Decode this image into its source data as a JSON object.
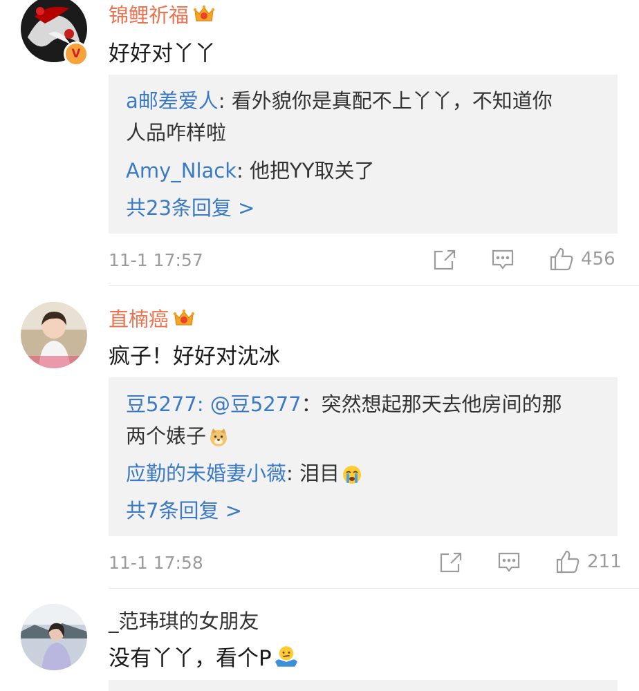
{
  "comments": [
    {
      "username": "锦鲤祈福",
      "text": "好好对丫丫",
      "replies": [
        {
          "user": "a邮差爱人",
          "sep": ": ",
          "text_line1": "看外貌你是真配不上丫丫，不知道你",
          "text_line2": "人品咋样啦"
        },
        {
          "user": "Amy_Nlack",
          "sep": ": ",
          "text": "他把YY取关了"
        }
      ],
      "more_replies": "共23条回复 >",
      "time": "11-1 17:57",
      "likes": "456"
    },
    {
      "username": "直楠癌",
      "text": "疯子！好好对沈冰",
      "replies": [
        {
          "user": "豆5277",
          "sep": ": ",
          "mention": "@豆5277",
          "text_line1": "：突然想起那天去他房间的那",
          "text_line2": "两个婊子"
        },
        {
          "user": "应勤的未婚妻小薇",
          "sep": ": ",
          "text": "泪目"
        }
      ],
      "more_replies": "共7条回复 >",
      "time": "11-1 17:58",
      "likes": "211"
    },
    {
      "username": "_范玮琪的女朋友",
      "text": "没有丫丫，看个P"
    }
  ],
  "icons": {
    "share": "share-icon",
    "comment": "comment-icon",
    "like": "thumbs-up-icon",
    "crown": "vip-crown-icon",
    "verified": "verified-v-badge"
  },
  "colors": {
    "vip_name": "#eb7350",
    "link_blue": "#3a7ac4",
    "reply_bg": "#f2f2f2",
    "meta_gray": "#9b9b9b"
  },
  "verified_badge": "V"
}
